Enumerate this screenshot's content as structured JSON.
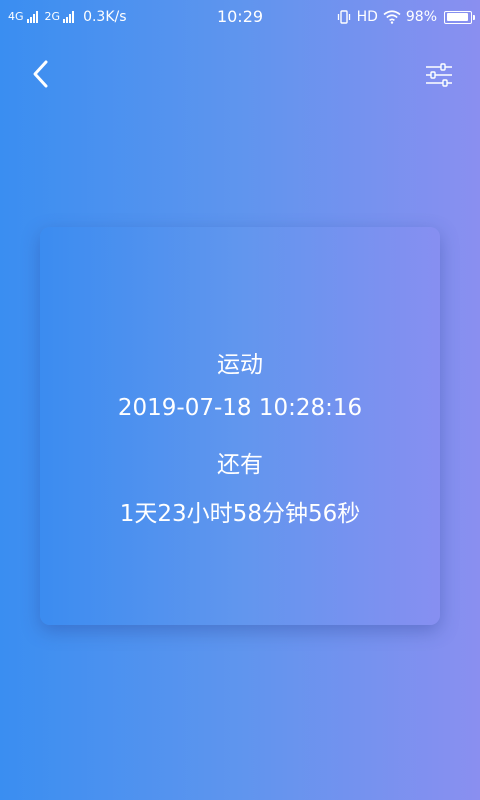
{
  "status_bar": {
    "network1": "4G",
    "network2": "2G",
    "speed": "0.3K/s",
    "time": "10:29",
    "hd": "HD",
    "battery": "98%",
    "battery_level": 0.98,
    "icons": [
      "signal-icon",
      "vibrate-icon",
      "wifi-icon",
      "battery-icon"
    ]
  },
  "header": {
    "back_icon": "back-arrow-icon",
    "settings_icon": "sliders-icon"
  },
  "countdown_card": {
    "event_name": "运动",
    "datetime": "2019-07-18 10:28:16",
    "remaining_label": "还有",
    "remaining_time": "1天23小时58分钟56秒"
  },
  "colors": {
    "gradient_start": "#3a8ef1",
    "gradient_end": "#8a8ff0",
    "text": "#ffffff"
  }
}
